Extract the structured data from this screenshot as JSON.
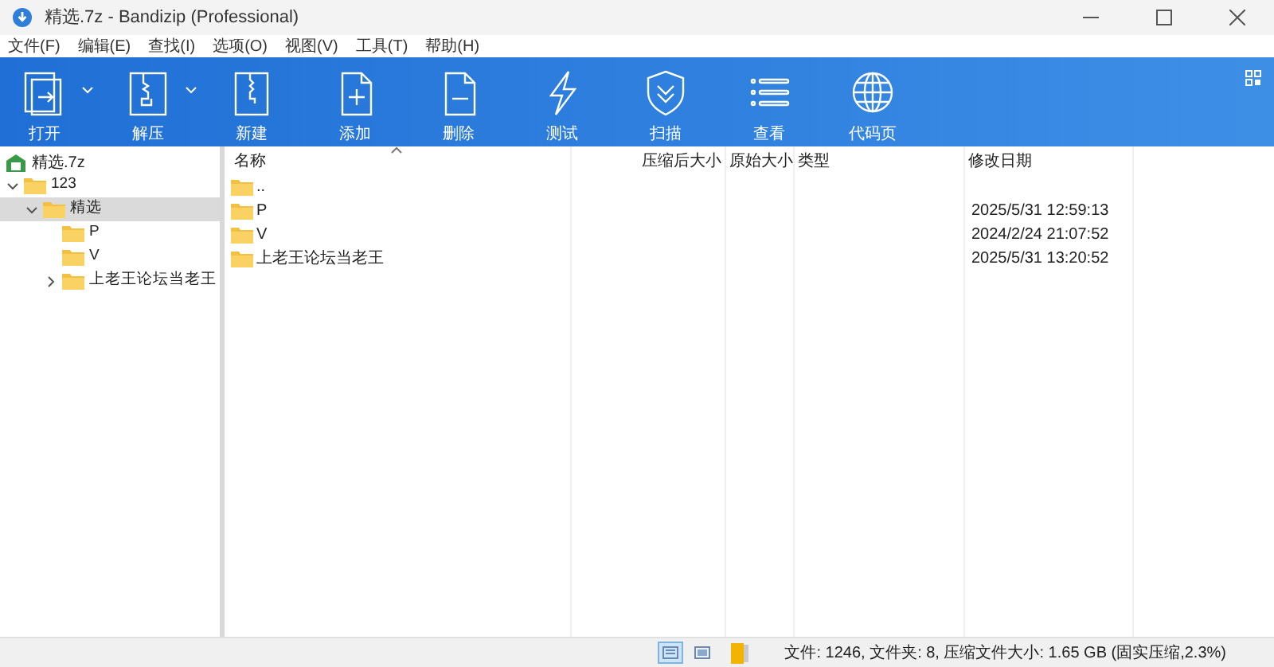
{
  "window": {
    "title": "精选.7z - Bandizip (Professional)"
  },
  "menu": [
    "文件(F)",
    "编辑(E)",
    "查找(I)",
    "选项(O)",
    "视图(V)",
    "工具(T)",
    "帮助(H)"
  ],
  "toolbar": [
    {
      "kind": "open",
      "label": "打开",
      "dropdown": true
    },
    {
      "kind": "extract",
      "label": "解压",
      "dropdown": true
    },
    {
      "kind": "new",
      "label": "新建",
      "dropdown": false
    },
    {
      "kind": "add",
      "label": "添加",
      "dropdown": false
    },
    {
      "kind": "delete",
      "label": "删除",
      "dropdown": false
    },
    {
      "kind": "test",
      "label": "测试",
      "dropdown": false
    },
    {
      "kind": "scan",
      "label": "扫描",
      "dropdown": false
    },
    {
      "kind": "view",
      "label": "查看",
      "dropdown": false
    },
    {
      "kind": "codepage",
      "label": "代码页",
      "dropdown": false
    }
  ],
  "tree": {
    "root": "精选.7z",
    "items": [
      {
        "label": "123",
        "expanded": true,
        "has_children": true,
        "selected": false,
        "children": [
          {
            "label": "精选",
            "expanded": true,
            "has_children": true,
            "selected": true,
            "children": [
              {
                "label": "P",
                "expanded": false,
                "has_children": false,
                "selected": false
              },
              {
                "label": "V",
                "expanded": false,
                "has_children": false,
                "selected": false
              },
              {
                "label": "上老王论坛当老王",
                "expanded": false,
                "has_children": true,
                "selected": false
              }
            ]
          }
        ]
      }
    ]
  },
  "table": {
    "columns": [
      "名称",
      "压缩后大小",
      "原始大小",
      "类型",
      "修改日期"
    ],
    "rows": [
      {
        "name": "..",
        "modified": ""
      },
      {
        "name": "P",
        "modified": "2025/5/31 12:59:13"
      },
      {
        "name": "V",
        "modified": "2024/2/24 21:07:52"
      },
      {
        "name": "上老王论坛当老王",
        "modified": "2025/5/31 13:20:52"
      }
    ]
  },
  "status_bar": {
    "views": [
      {
        "kind": "details",
        "selected": true
      },
      {
        "kind": "thumbnails",
        "selected": false
      }
    ],
    "text": "文件: 1246, 文件夹: 8, 压缩文件大小: 1.65 GB (固实压缩,2.3%)"
  }
}
